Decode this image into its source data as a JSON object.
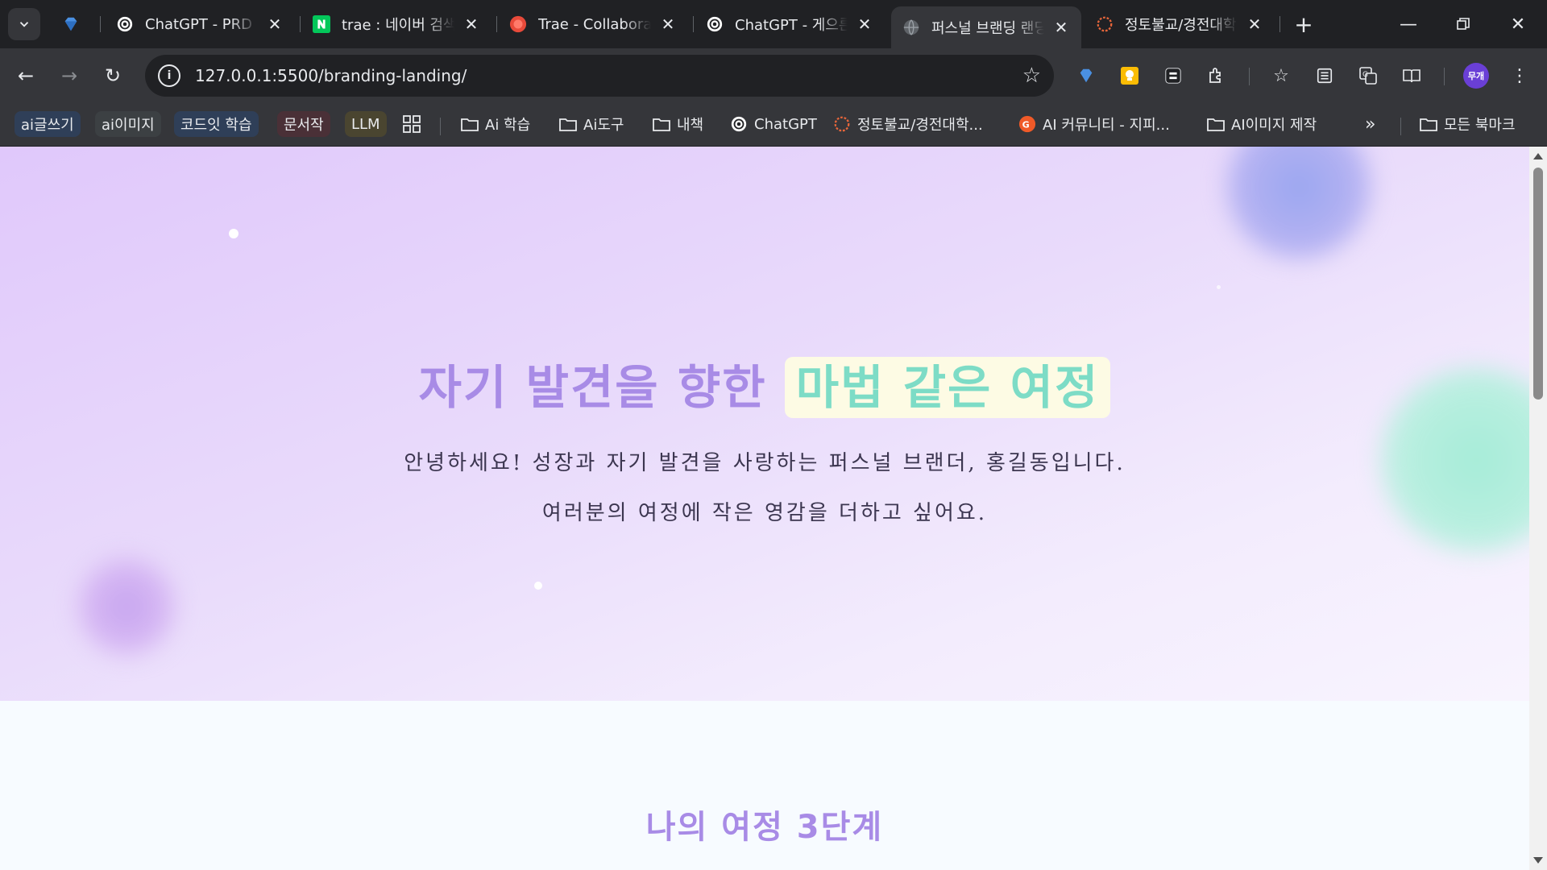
{
  "tabs": [
    {
      "title": "ChatGPT - PRD",
      "icon": "openai-icon"
    },
    {
      "title": "trae : 네이버 검색",
      "icon": "naver-icon"
    },
    {
      "title": "Trae - Collaborate",
      "icon": "trae-icon"
    },
    {
      "title": "ChatGPT - 게으른",
      "icon": "openai-icon"
    },
    {
      "title": "퍼스널 브랜딩 랜딩",
      "icon": "globe-icon",
      "active": true
    },
    {
      "title": "정토불교/경전대학",
      "icon": "jungto-icon"
    }
  ],
  "omnibox": {
    "url": "127.0.0.1:5500/branding-landing/"
  },
  "profile": {
    "label": "무개"
  },
  "bookmarks": {
    "chips": [
      {
        "label": "ai글쓰기",
        "bg": "#2f3f58"
      },
      {
        "label": "ai이미지",
        "bg": "#3c4043"
      },
      {
        "label": "코드잇 학습",
        "bg": "#2f3f58"
      },
      {
        "label": "문서작",
        "bg": "#4a3037"
      },
      {
        "label": "LLM",
        "bg": "#4a4530"
      }
    ],
    "items": [
      {
        "label": "Ai 학습",
        "icon": "folder-icon"
      },
      {
        "label": "Ai도구",
        "icon": "folder-icon"
      },
      {
        "label": "내책",
        "icon": "folder-icon"
      },
      {
        "label": "ChatGPT",
        "icon": "openai-icon"
      },
      {
        "label": "정토불교/경전대학...",
        "icon": "jungto-icon"
      },
      {
        "label": "AI 커뮤니티 - 지피...",
        "icon": "gpters-icon"
      },
      {
        "label": "AI이미지 제작",
        "icon": "folder-icon"
      }
    ],
    "all_bookmarks": "모든 북마크"
  },
  "hero": {
    "title_main": "자기 발견을 향한 ",
    "title_highlight": "마법 같은 여정",
    "line1": "안녕하세요! 성장과 자기 발견을 사랑하는 퍼스널 브랜더, 홍길동입니다.",
    "line2": "여러분의 여정에 작은 영감을 더하고 싶어요."
  },
  "section": {
    "title": "나의 여정 3단계"
  },
  "colors": {
    "accent_purple": "#a88be6",
    "accent_mint": "#7ddcc6",
    "highlight_bg": "#fdfbe4"
  }
}
